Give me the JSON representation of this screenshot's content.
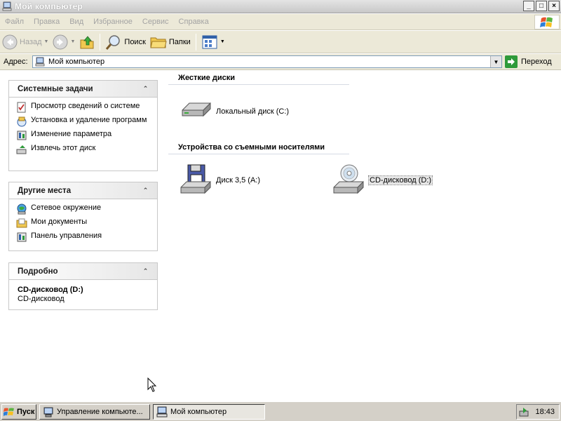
{
  "window": {
    "title": "Мой компьютер",
    "controls": [
      "_",
      "□",
      "×"
    ]
  },
  "menu": {
    "items": [
      "Файл",
      "Правка",
      "Вид",
      "Избранное",
      "Сервис",
      "Справка"
    ]
  },
  "toolbar": {
    "back_label": "Назад",
    "search_label": "Поиск",
    "folders_label": "Папки"
  },
  "address": {
    "label": "Адрес:",
    "value": "Мой компьютер",
    "go_label": "Переход"
  },
  "sidebar": {
    "system_tasks": {
      "title": "Системные задачи",
      "items": [
        {
          "label": "Просмотр сведений о системе",
          "icon": "system-info-icon"
        },
        {
          "label": "Установка и удаление программ",
          "icon": "add-remove-programs-icon"
        },
        {
          "label": "Изменение параметра",
          "icon": "control-panel-icon"
        },
        {
          "label": "Извлечь этот диск",
          "icon": "eject-disk-icon"
        }
      ]
    },
    "other_places": {
      "title": "Другие места",
      "items": [
        {
          "label": "Сетевое окружение",
          "icon": "network-icon"
        },
        {
          "label": "Мои документы",
          "icon": "documents-icon"
        },
        {
          "label": "Панель управления",
          "icon": "control-panel-icon"
        }
      ]
    },
    "details": {
      "title": "Подробно",
      "name": "CD-дисковод (D:)",
      "type": "CD-дисковод"
    }
  },
  "content": {
    "hard_drives_header": "Жесткие диски",
    "removable_header": "Устройства со съемными носителями",
    "drives": {
      "local_c": "Локальный диск (C:)",
      "floppy_a": "Диск 3,5 (A:)",
      "cd_d": "CD-дисковод (D:)"
    }
  },
  "taskbar": {
    "start_label": "Пуск",
    "buttons": [
      "Управление компьюте...",
      "Мой компьютер"
    ],
    "clock": "18:43"
  },
  "colors": {
    "bars": "#ece9d8",
    "accent_green": "#2e9a3a"
  }
}
